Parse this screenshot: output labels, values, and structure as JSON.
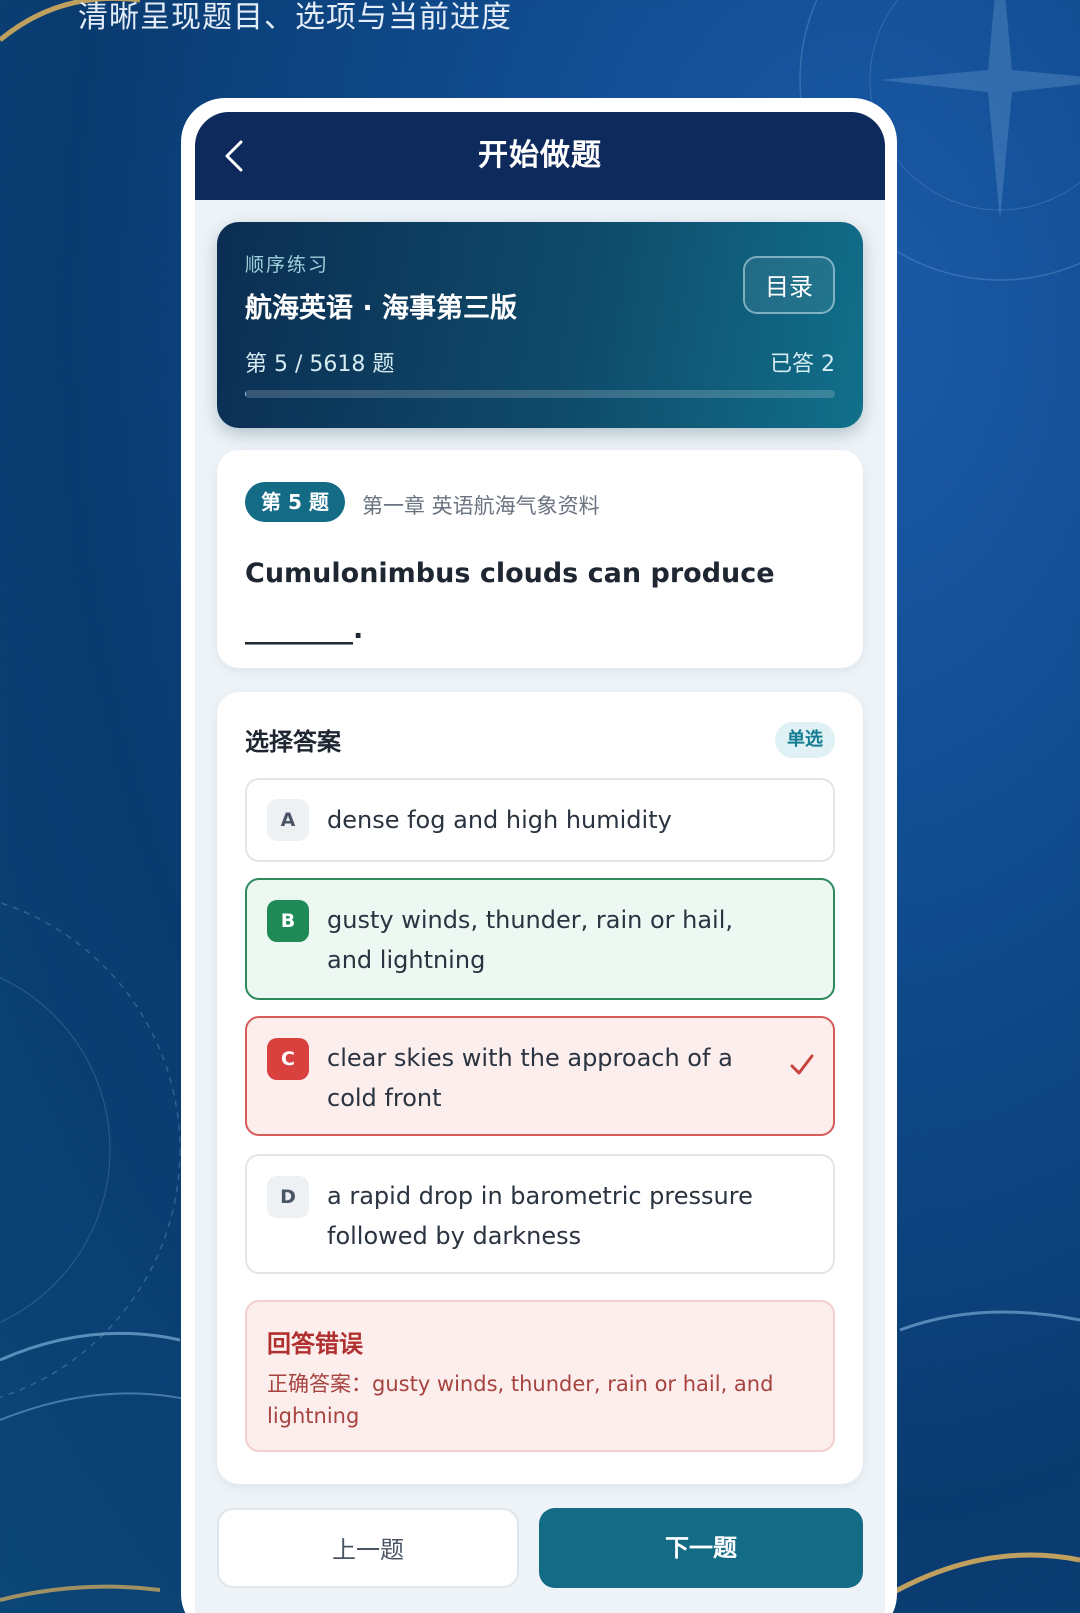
{
  "banner": {
    "caption": "清晰呈现题目、选项与当前进度"
  },
  "navbar": {
    "title": "开始做题",
    "back_icon": "chevron-left-icon"
  },
  "progress": {
    "mode": "顺序练习",
    "book_title": "航海英语 · 海事第三版",
    "catalog_label": "目录",
    "progress_text": "第 5 / 5618 题",
    "answered_text": "已答 2",
    "fraction": 0.0009
  },
  "question": {
    "badge": "第 5 题",
    "chapter": "第一章 英语航海气象资料",
    "text": "Cumulonimbus clouds can produce ________."
  },
  "answers": {
    "title": "选择答案",
    "type_badge": "单选",
    "options": [
      {
        "letter": "A",
        "text": "dense fog and high humidity",
        "state": "normal"
      },
      {
        "letter": "B",
        "text": "gusty winds, thunder, rain or hail, and lightning",
        "state": "correct"
      },
      {
        "letter": "C",
        "text": "clear skies with the approach of a cold front",
        "state": "wrong"
      },
      {
        "letter": "D",
        "text": "a rapid drop in barometric pressure followed by darkness",
        "state": "normal"
      }
    ],
    "selected_icon": "check-icon"
  },
  "result": {
    "title": "回答错误",
    "body": "正确答案：gusty winds, thunder, rain or hail, and lightning"
  },
  "buttons": {
    "prev_label": "上一题",
    "next_label": "下一题"
  },
  "colors": {
    "navbar": "#0e2a5c",
    "accent": "#146b86",
    "correct": "#1f8a55",
    "wrong": "#d9413f"
  }
}
